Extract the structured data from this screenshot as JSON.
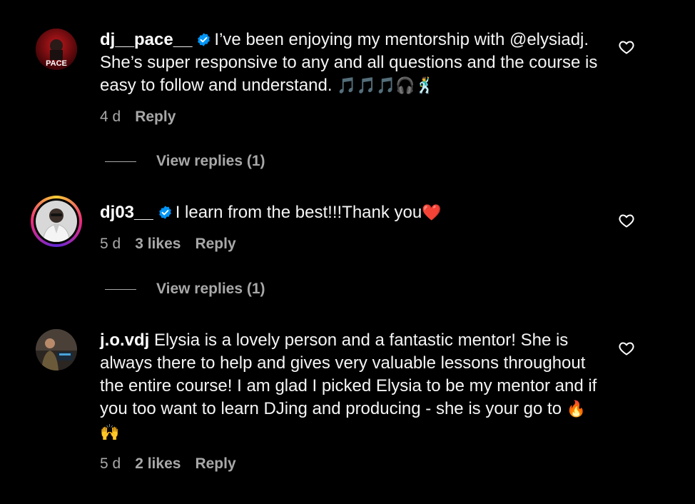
{
  "comments": [
    {
      "username": "dj__pace__",
      "verified": true,
      "text": "I’ve been enjoying my mentorship with @elysiadj. She’s super responsive to any and all questions and the course is easy to follow and understand.",
      "emoji": "🎵🎵🎵🎧🕺",
      "age": "4 d",
      "likes": "",
      "reply_label": "Reply",
      "view_replies": "View replies (1)",
      "avatar_text": "PACE"
    },
    {
      "username": "dj03__",
      "verified": true,
      "text": "I learn from the best!!!Thank you",
      "emoji": "❤️",
      "age": "5 d",
      "likes": "3 likes",
      "reply_label": "Reply",
      "view_replies": "View replies (1)"
    },
    {
      "username": "j.o.vdj",
      "verified": false,
      "text": "Elysia is a lovely person and a fantastic mentor! She is always there to help and gives very valuable lessons throughout the entire course! I am glad I picked Elysia to be my mentor and if you too want to learn DJing and producing - she is your go to",
      "emoji": "🔥🙌",
      "age": "5 d",
      "likes": "2 likes",
      "reply_label": "Reply"
    }
  ],
  "icons": {
    "like": "heart-outline-icon",
    "verified": "verified-badge-icon"
  },
  "colors": {
    "background": "#000000",
    "text": "#f5f5f5",
    "muted": "#a8a8a8",
    "verified": "#0095f6"
  }
}
